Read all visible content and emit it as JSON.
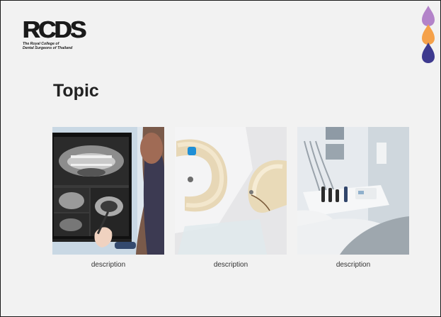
{
  "logo": {
    "wordmark": "RCDS",
    "subtitle_line1": "The Royal College of",
    "subtitle_line2": "Dental Surgeons of Thailand"
  },
  "decor": {
    "drop_colors": [
      "#b383c9",
      "#f5a14a",
      "#3e3a8f"
    ]
  },
  "page": {
    "title": "Topic"
  },
  "cards": [
    {
      "image": "dental-xray-monitor-photo",
      "caption": "description"
    },
    {
      "image": "dental-models-photo",
      "caption": "description"
    },
    {
      "image": "dental-chair-equipment-photo",
      "caption": "description"
    }
  ]
}
